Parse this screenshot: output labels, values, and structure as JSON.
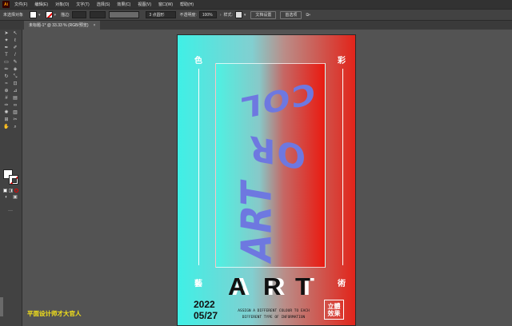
{
  "menubar": {
    "logo": "Ai",
    "items": [
      "文件(F)",
      "编辑(E)",
      "对象(O)",
      "文字(T)",
      "选择(S)",
      "效果(C)",
      "视图(V)",
      "窗口(W)",
      "帮助(H)"
    ]
  },
  "controlbar": {
    "selection_label": "未选择对象",
    "stroke_label": "描边:",
    "brush_value": "3 点圆形",
    "opacity_label": "不透明度:",
    "opacity_value": "100%",
    "style_label": "样式:",
    "doc_setup_button": "文档设置",
    "prefs_button": "首选项"
  },
  "tab": {
    "title": "未标题-1* @ 33.33 % (RGB/预览)",
    "close": "×"
  },
  "poster": {
    "corner_tl": "色",
    "corner_tr": "彩",
    "corner_bl": "藝",
    "corner_br": "術",
    "art_letters": [
      "A",
      "R",
      "T"
    ],
    "wavy_top": "COL",
    "wavy_mid": "OR",
    "wavy_bottom": "ART",
    "date_year": "2022",
    "date_day": "05/27",
    "caption_line1": "ASSIGN A DIFFERENT COLOUR TO EACH",
    "caption_line2": "DIFFERENT TYPE OF INFORMATION",
    "stamp_line1": "立體",
    "stamp_line2": "效果"
  },
  "watermark": "平面设计师才大官人",
  "colors": {
    "gradient_left": "#3ff0e6",
    "gradient_right": "#e2241a",
    "wavy_text": "#6e78e0",
    "watermark": "#f5e21a"
  }
}
